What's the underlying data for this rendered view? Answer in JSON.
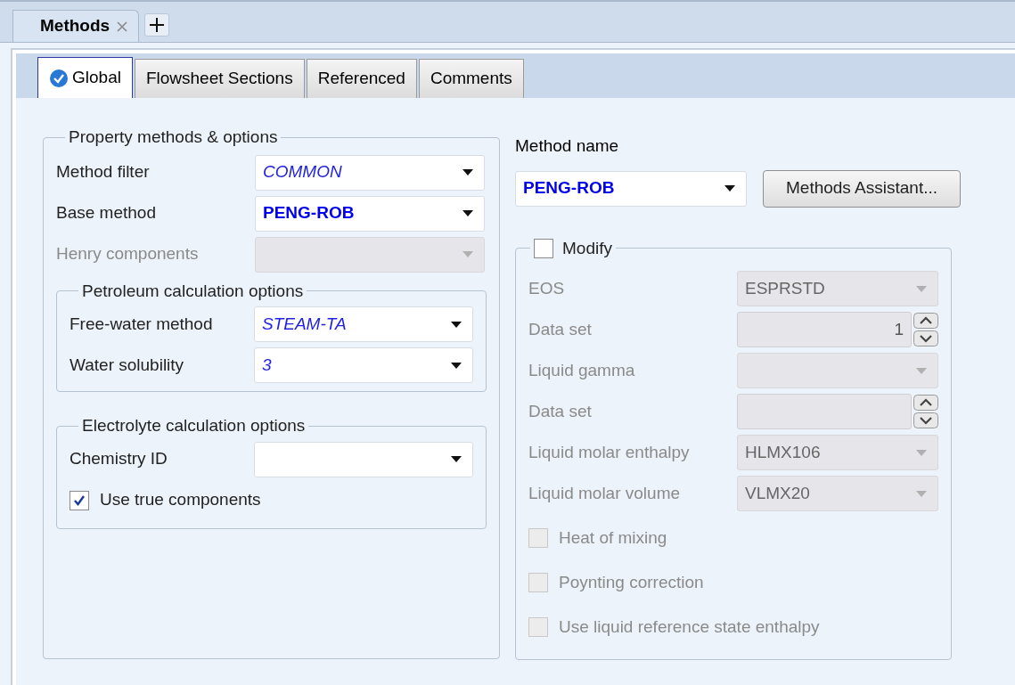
{
  "document_tabs": [
    {
      "label": "Methods",
      "selected": true
    }
  ],
  "tabs": [
    {
      "label": "Global",
      "selected": true,
      "complete": true
    },
    {
      "label": "Flowsheet Sections",
      "selected": false,
      "complete": false
    },
    {
      "label": "Referenced",
      "selected": false,
      "complete": false
    },
    {
      "label": "Comments",
      "selected": false,
      "complete": false
    }
  ],
  "property_methods": {
    "title": "Property methods & options",
    "fields": [
      {
        "label": "Method filter",
        "value": "COMMON",
        "kind": "default",
        "disabled": false
      },
      {
        "label": "Base method",
        "value": "PENG-ROB",
        "kind": "entered",
        "disabled": false
      },
      {
        "label": "Henry components",
        "disabled": true
      }
    ]
  },
  "petroleum": {
    "title": "Petroleum calculation options",
    "fields": [
      {
        "label": "Free-water method",
        "value": "STEAM-TA",
        "kind": "default",
        "disabled": false
      },
      {
        "label": "Water solubility",
        "value": "3",
        "kind": "default",
        "disabled": false
      }
    ]
  },
  "electrolyte": {
    "title": "Electrolyte calculation options",
    "fields": [
      {
        "label": "Chemistry ID",
        "disabled": false
      }
    ],
    "checkbox": {
      "label": "Use true components",
      "checked": true
    }
  },
  "method_name": {
    "label": "Method name",
    "value": "PENG-ROB",
    "kind": "entered"
  },
  "assistant_button": "Methods Assistant...",
  "modify": {
    "label": "Modify",
    "checked": false,
    "fields": [
      {
        "kind": "dropdown",
        "label": "EOS",
        "value": "ESPRSTD",
        "disabled": true
      },
      {
        "kind": "spin",
        "label": "Data set",
        "value": "1",
        "disabled": true
      },
      {
        "kind": "dropdown",
        "label": "Liquid gamma",
        "disabled": true
      },
      {
        "kind": "spin",
        "label": "Data set",
        "disabled": true
      },
      {
        "kind": "dropdown",
        "label": "Liquid molar enthalpy",
        "value": "HLMX106",
        "disabled": true
      },
      {
        "kind": "dropdown",
        "label": "Liquid molar volume",
        "value": "VLMX20",
        "disabled": true
      }
    ],
    "options": [
      {
        "label": "Heat of mixing",
        "checked": false,
        "disabled": true
      },
      {
        "label": "Poynting correction",
        "checked": false,
        "disabled": true
      },
      {
        "label": "Use liquid reference state enthalpy",
        "checked": false,
        "disabled": true
      }
    ]
  }
}
